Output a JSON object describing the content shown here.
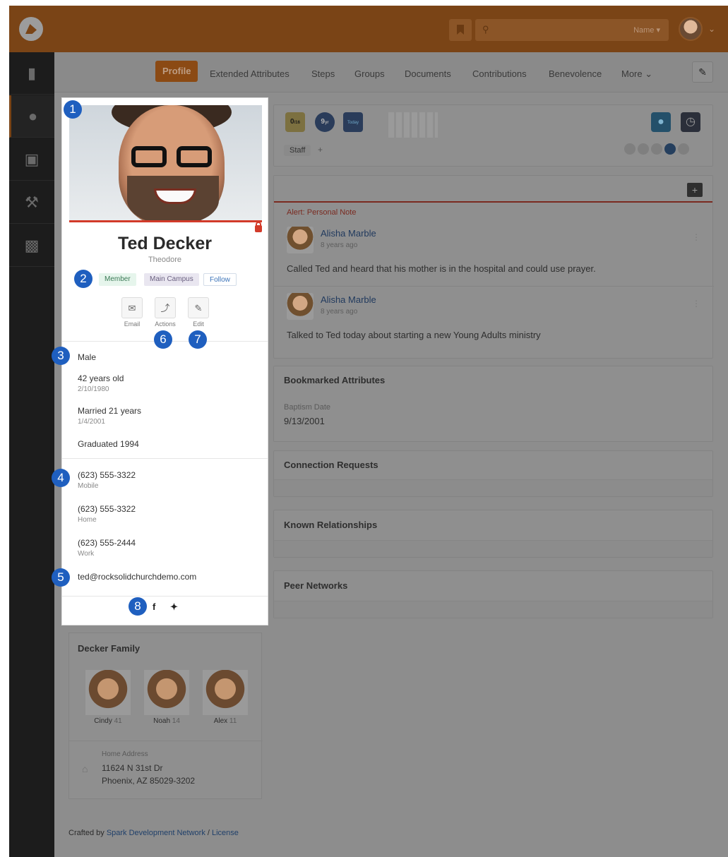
{
  "search": {
    "scope": "Name"
  },
  "nav": {
    "tabs": [
      "Profile",
      "Extended Attributes",
      "Steps",
      "Groups",
      "Documents",
      "Contributions",
      "Benevolence",
      "More"
    ]
  },
  "badges": {
    "zero": "0",
    "zero_unit": "/16",
    "years": "9",
    "years_unit": "yr",
    "today": "Today",
    "staff": "Staff"
  },
  "notes": {
    "alert": "Alert: Personal Note",
    "items": [
      {
        "author": "Alisha Marble",
        "time": "8 years ago",
        "text": "Called Ted and heard that his mother is in the hospital and could use prayer."
      },
      {
        "author": "Alisha Marble",
        "time": "8 years ago",
        "text": "Talked to Ted today about starting a new Young Adults ministry"
      }
    ]
  },
  "bookmarked": {
    "title": "Bookmarked Attributes",
    "label": "Baptism Date",
    "value": "9/13/2001"
  },
  "sections": {
    "connection": "Connection Requests",
    "known": "Known Relationships",
    "peer": "Peer Networks"
  },
  "person": {
    "name": "Ted Decker",
    "nickname": "Theodore",
    "tags": [
      "Member",
      "Main Campus",
      "Follow"
    ],
    "actions": [
      "Email",
      "Actions",
      "Edit"
    ],
    "gender": "Male",
    "age": "42 years old",
    "birthdate": "2/10/1980",
    "marriage": "Married 21 years",
    "anniversary": "1/4/2001",
    "graduation": "Graduated 1994",
    "phones": [
      {
        "number": "(623) 555-3322",
        "type": "Mobile"
      },
      {
        "number": "(623) 555-3322",
        "type": "Home"
      },
      {
        "number": "(623) 555-2444",
        "type": "Work"
      }
    ],
    "email": "ted@rocksolidchurchdemo.com"
  },
  "callouts": [
    "1",
    "2",
    "3",
    "4",
    "5",
    "6",
    "7",
    "8"
  ],
  "family": {
    "title": "Decker Family",
    "members": [
      {
        "name": "Cindy",
        "age": "41"
      },
      {
        "name": "Noah",
        "age": "14"
      },
      {
        "name": "Alex",
        "age": "11"
      }
    ],
    "address_label": "Home Address",
    "address_line1": "11624 N 31st Dr",
    "address_line2": "Phoenix, AZ 85029-3202"
  },
  "footer": {
    "prefix": "Crafted by",
    "org": "Spark Development Network",
    "sep": " / ",
    "license": "License"
  },
  "colors": {
    "accent": "#d23b2a",
    "callout": "#1f5fbf",
    "link": "#3b73b9"
  },
  "icons": [
    "rock-logo-icon",
    "bookmark-icon",
    "search-icon",
    "book-icon",
    "person-icon",
    "money-icon",
    "wrench-icon",
    "briefcase-icon",
    "pencil-icon",
    "envelope-icon",
    "bolt-icon",
    "lock-icon",
    "facebook-icon",
    "twitter-icon",
    "home-icon",
    "plus-icon",
    "drop-icon",
    "clock-icon"
  ]
}
